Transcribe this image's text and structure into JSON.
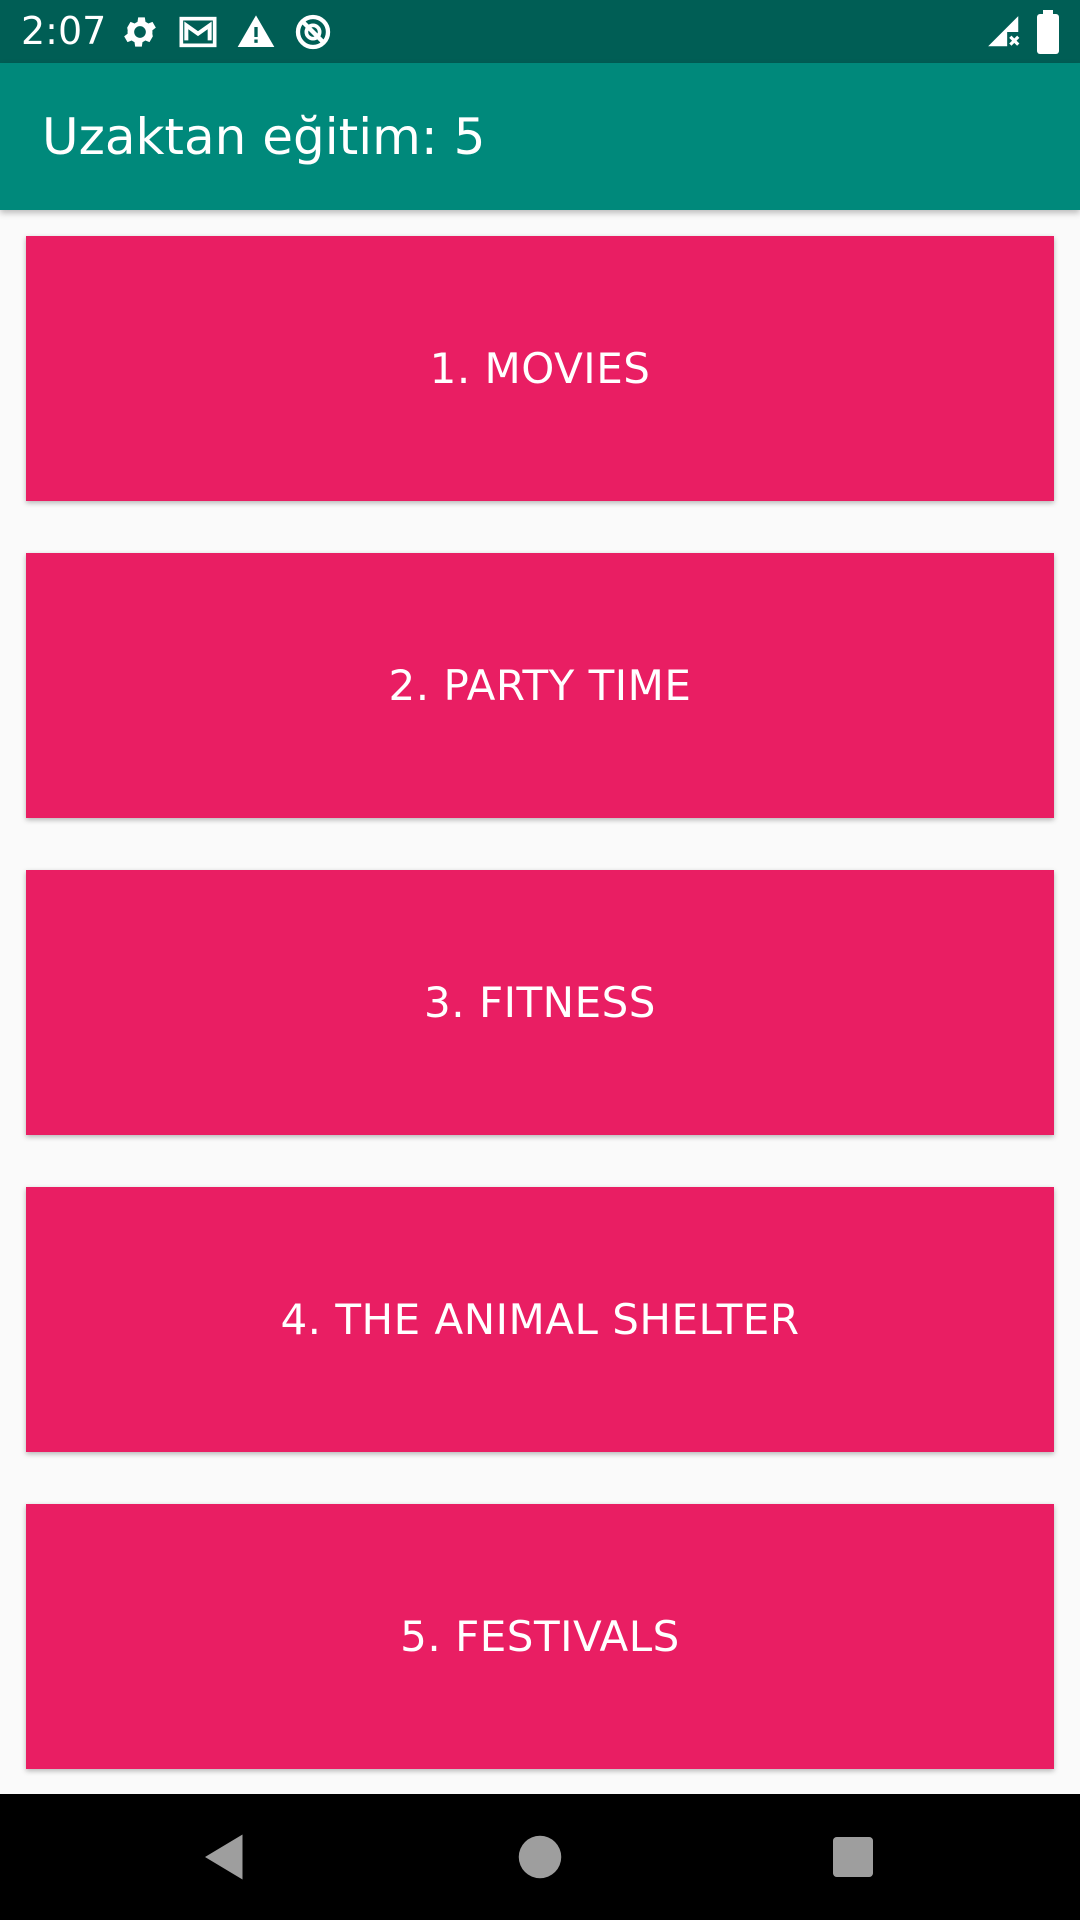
{
  "status_bar": {
    "time": "2:07",
    "icons": [
      "gear-icon",
      "gmail-icon",
      "warning-icon",
      "do-not-disturb-icon",
      "signal-no-data-icon",
      "battery-icon"
    ],
    "background": "#005e55"
  },
  "app_bar": {
    "title": "Uzaktan eğitim: 5",
    "background": "#00897b"
  },
  "menu": {
    "accent": "#e91e63",
    "items": [
      {
        "label": "1. MOVIES"
      },
      {
        "label": "2. PARTY TIME"
      },
      {
        "label": "3. FITNESS"
      },
      {
        "label": "4. THE ANIMAL SHELTER"
      },
      {
        "label": "5. FESTIVALS"
      }
    ]
  },
  "nav_bar": {
    "icons": [
      "back-icon",
      "home-icon",
      "recents-icon"
    ]
  }
}
